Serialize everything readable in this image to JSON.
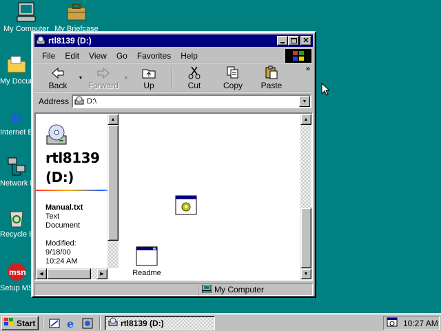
{
  "desktop": {
    "icons": [
      {
        "label": "My Computer",
        "icon": "computer-icon"
      },
      {
        "label": "My Briefcase",
        "icon": "briefcase-icon"
      },
      {
        "label": "My Documents",
        "icon": "folder-icon"
      },
      {
        "label": "Internet Explorer",
        "icon": "ie-icon"
      },
      {
        "label": "Network Neighborhood",
        "icon": "network-icon"
      },
      {
        "label": "Recycle Bin",
        "icon": "recycle-bin-icon"
      },
      {
        "label": "Setup MSN Internet A...",
        "icon": "msn-icon"
      }
    ]
  },
  "window": {
    "title": "rtl8139 (D:)",
    "menu": [
      "File",
      "Edit",
      "View",
      "Go",
      "Favorites",
      "Help"
    ],
    "toolbar": {
      "back": "Back",
      "forward": "Forward",
      "up": "Up",
      "cut": "Cut",
      "copy": "Copy",
      "paste": "Paste"
    },
    "address": {
      "label": "Address",
      "value": "D:\\"
    },
    "left_pane": {
      "title_line1": "rtl8139",
      "title_line2": "(D:)",
      "file_name": "Manual.txt",
      "file_type_line1": "Text",
      "file_type_line2": "Document",
      "modified_label": "Modified:",
      "modified_date": "9/18/00",
      "modified_time": "10:24 AM"
    },
    "files": [
      {
        "label": "",
        "icon": "setup-app-icon"
      },
      {
        "label": "Readme",
        "icon": "application-window-icon"
      }
    ],
    "status": {
      "zone": "My Computer"
    }
  },
  "taskbar": {
    "start_label": "Start",
    "task_label": "rtl8139 (D:)",
    "clock": "10:27 AM"
  },
  "colors": {
    "desktop": "#008080",
    "titlebar": "#000080",
    "face": "#c0c0c0"
  }
}
